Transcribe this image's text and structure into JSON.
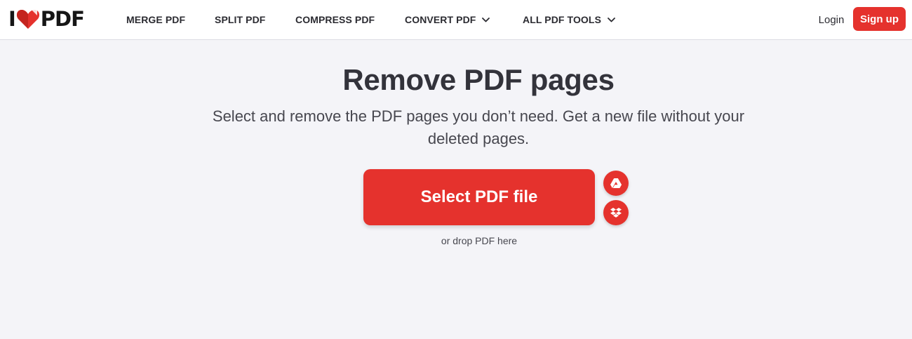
{
  "header": {
    "logo_left": "I",
    "logo_right": "PDF",
    "nav": {
      "merge": "MERGE PDF",
      "split": "SPLIT PDF",
      "compress": "COMPRESS PDF",
      "convert": "CONVERT PDF",
      "all_tools": "ALL PDF TOOLS"
    },
    "login": "Login",
    "signup": "Sign up"
  },
  "main": {
    "title": "Remove PDF pages",
    "subtitle": "Select and remove the PDF pages you don’t need. Get a new file without your deleted pages.",
    "select_button": "Select PDF file",
    "drop_hint": "or drop PDF here",
    "cloud_sources": [
      "google-drive-icon",
      "dropbox-icon"
    ]
  },
  "colors": {
    "brand_red": "#e5322d",
    "background": "#f4f4f8",
    "header_bg": "#ffffff",
    "text_dark": "#33333b"
  }
}
